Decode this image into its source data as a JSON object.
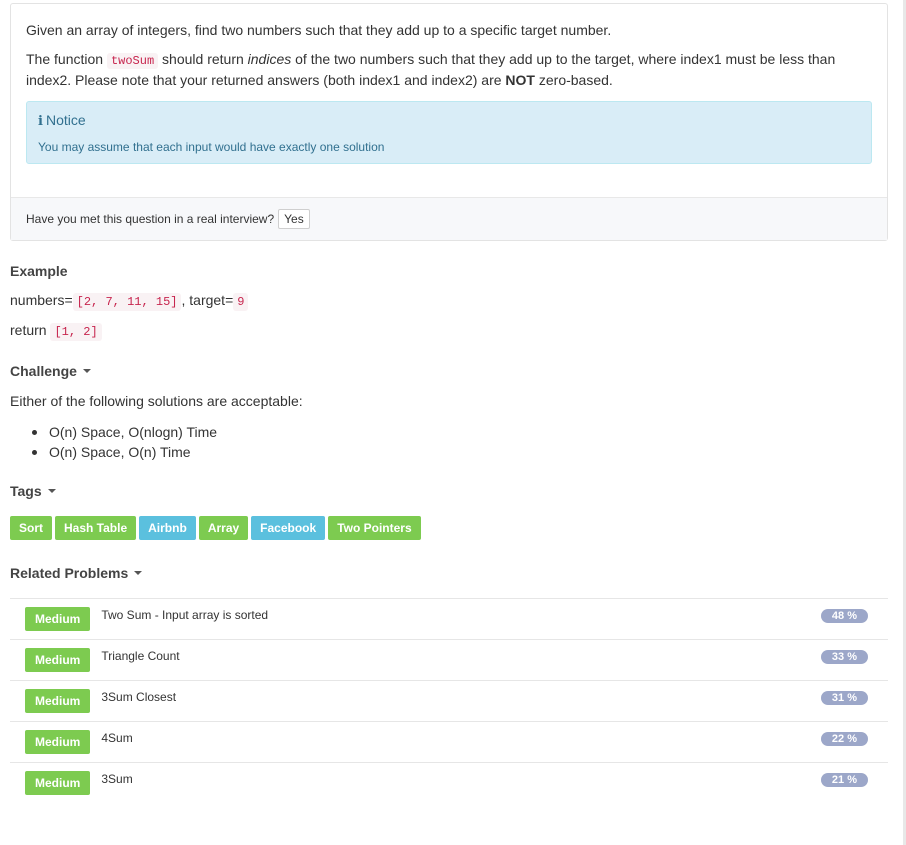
{
  "description": {
    "intro": "Given an array of integers, find two numbers such that they add up to a specific target number.",
    "p2_before": "The function ",
    "p2_code": "twoSum",
    "p2_mid1": " should return ",
    "p2_em": "indices",
    "p2_mid2": " of the two numbers such that they add up to the target, where index1 must be less than index2. Please note that your returned answers (both index1 and index2) are ",
    "p2_strong": "NOT",
    "p2_after": " zero-based.",
    "notice_title": "Notice",
    "notice_text": "You may assume that each input would have exactly one solution",
    "footer_question": "Have you met this question in a real interview?",
    "footer_yes": "Yes"
  },
  "example": {
    "title": "Example",
    "line1_label": "numbers=",
    "line1_code": "[2, 7, 11, 15]",
    "line1_mid": ", target=",
    "line1_code2": "9",
    "line2_label": "return",
    "line2_code": "[1, 2]"
  },
  "challenge": {
    "title": "Challenge",
    "intro": "Either of the following solutions are acceptable:",
    "items": [
      "O(n) Space, O(nlogn) Time",
      "O(n) Space, O(n) Time"
    ]
  },
  "tags": {
    "title": "Tags",
    "items": [
      {
        "label": "Sort",
        "color": "#7dcb50"
      },
      {
        "label": "Hash Table",
        "color": "#7dcb50"
      },
      {
        "label": "Airbnb",
        "color": "#5bc0de"
      },
      {
        "label": "Array",
        "color": "#7dcb50"
      },
      {
        "label": "Facebook",
        "color": "#5bc0de"
      },
      {
        "label": "Two Pointers",
        "color": "#7dcb50"
      }
    ]
  },
  "related": {
    "title": "Related Problems",
    "rows": [
      {
        "difficulty": "Medium",
        "name": "Two Sum - Input array is sorted",
        "percent": "48 %"
      },
      {
        "difficulty": "Medium",
        "name": "Triangle Count",
        "percent": "33 %"
      },
      {
        "difficulty": "Medium",
        "name": "3Sum Closest",
        "percent": "31 %"
      },
      {
        "difficulty": "Medium",
        "name": "4Sum",
        "percent": "22 %"
      },
      {
        "difficulty": "Medium",
        "name": "3Sum",
        "percent": "21 %"
      }
    ]
  },
  "colors": {
    "tag_green": "#7dcb50",
    "tag_blue": "#5bc0de",
    "percent_badge": "#9ca7c9",
    "notice_bg": "#d9edf7",
    "code_red": "#c7254e"
  }
}
